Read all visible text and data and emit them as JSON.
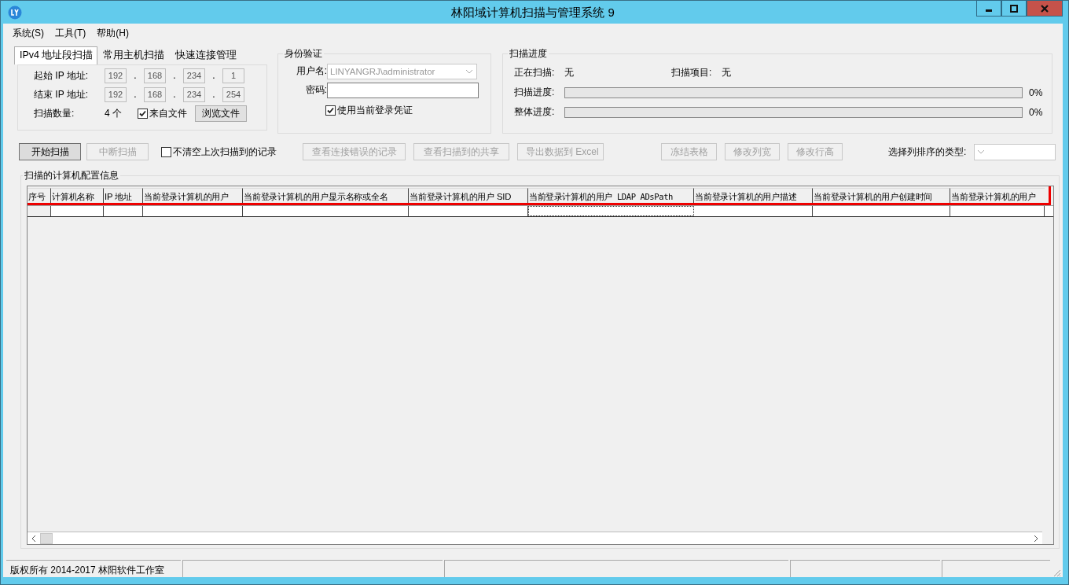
{
  "window": {
    "title": "林阳域计算机扫描与管理系统 9"
  },
  "menu": [
    {
      "label": "系统(S)"
    },
    {
      "label": "工具(T)"
    },
    {
      "label": "帮助(H)"
    }
  ],
  "tabs": [
    {
      "label": "IPv4 地址段扫描",
      "selected": true
    },
    {
      "label": "常用主机扫描",
      "selected": false
    },
    {
      "label": "快速连接管理",
      "selected": false
    }
  ],
  "ip_range": {
    "rows": [
      {
        "label": "起始 IP 地址:",
        "octets": [
          "192",
          "168",
          "234",
          "1"
        ]
      },
      {
        "label": "结束 IP 地址:",
        "octets": [
          "192",
          "168",
          "234",
          "254"
        ]
      }
    ],
    "separator": ".",
    "count_label": "扫描数量:",
    "count_value": "4 个",
    "from_file": {
      "label": "来自文件",
      "checked": true
    },
    "browse_button": {
      "label": "浏览文件",
      "disabled": false
    }
  },
  "auth": {
    "title": "身份验证",
    "username": {
      "label": "用户名:",
      "value": "LINYANGRJ\\administrator",
      "disabled": true
    },
    "password": {
      "label": "密码:"
    },
    "use_current": {
      "label": "使用当前登录凭证",
      "checked": true
    }
  },
  "progress": {
    "title": "扫描进度",
    "scanning": {
      "label": "正在扫描:",
      "value": "无"
    },
    "item": {
      "label": "扫描项目:",
      "value": "无"
    },
    "bars": [
      {
        "label": "扫描进度:",
        "level": 0,
        "reading": "0%"
      },
      {
        "label": "整体进度:",
        "level": 0,
        "reading": "0%"
      }
    ]
  },
  "toolbar": [
    {
      "kind": "button",
      "label": "开始扫描",
      "disabled": false,
      "default": true
    },
    {
      "kind": "button",
      "label": "中断扫描",
      "disabled": true,
      "default": false
    },
    {
      "kind": "checkbox",
      "label": "不清空上次扫描到的记录",
      "checked": false
    },
    {
      "kind": "button",
      "label": "查看连接错误的记录",
      "disabled": true,
      "default": false
    },
    {
      "kind": "button",
      "label": "查看扫描到的共享",
      "disabled": true,
      "default": false
    },
    {
      "kind": "button",
      "label": "导出数据到 Excel",
      "disabled": true,
      "default": false
    },
    {
      "kind": "button",
      "label": "冻结表格",
      "disabled": true,
      "default": false
    },
    {
      "kind": "button",
      "label": "修改列宽",
      "disabled": true,
      "default": false
    },
    {
      "kind": "button",
      "label": "修改行高",
      "disabled": true,
      "default": false
    },
    {
      "kind": "dropdown",
      "label": "选择列排序的类型:"
    }
  ],
  "table": {
    "title": "扫描的计算机配置信息",
    "columns": [
      {
        "label": "序号"
      },
      {
        "label": "计算机名称"
      },
      {
        "label": "IP 地址"
      },
      {
        "label": "当前登录计算机的用户"
      },
      {
        "label": "当前登录计算机的用户显示名称或全名"
      },
      {
        "label": "当前登录计算机的用户 SID"
      },
      {
        "label": "当前登录计算机的用户 LDAP ADsPath"
      },
      {
        "label": "当前登录计算机的用户描述"
      },
      {
        "label": "当前登录计算机的用户创建时间"
      },
      {
        "label": "当前登录计算机的用户"
      }
    ]
  },
  "status_bar": [
    {
      "text": "版权所有 2014-2017 林阳软件工作室"
    }
  ]
}
